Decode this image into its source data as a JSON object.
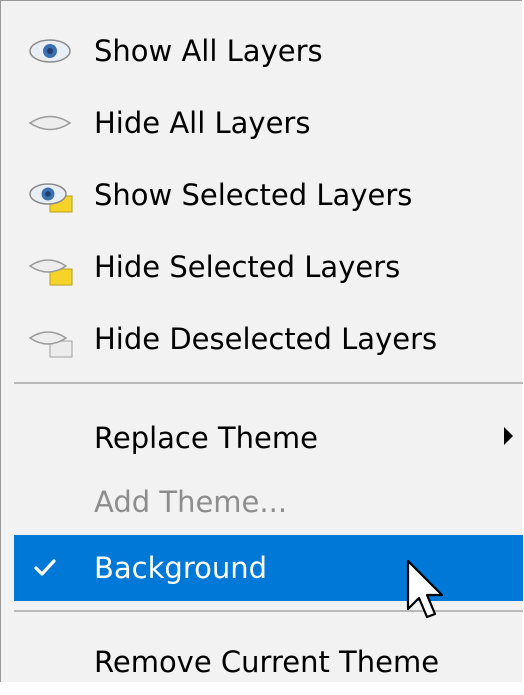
{
  "menu": {
    "items": [
      {
        "label": "Show All Layers",
        "icon": "eye-open-icon",
        "state": "enabled"
      },
      {
        "label": "Hide All Layers",
        "icon": "eye-closed-icon",
        "state": "enabled"
      },
      {
        "label": "Show Selected Layers",
        "icon": "eye-open-selected-icon",
        "state": "enabled"
      },
      {
        "label": "Hide Selected Layers",
        "icon": "eye-closed-selected-icon",
        "state": "enabled"
      },
      {
        "label": "Hide Deselected Layers",
        "icon": "eye-closed-deselected-icon",
        "state": "enabled"
      },
      {
        "label": "Replace Theme",
        "icon": "chevron-right-icon",
        "state": "enabled",
        "has_submenu": true
      },
      {
        "label": "Add Theme...",
        "state": "disabled"
      },
      {
        "label": "Background",
        "icon": "checkmark-icon",
        "state": "selected",
        "checked": true
      },
      {
        "label": "Remove Current Theme",
        "state": "enabled"
      }
    ]
  },
  "colors": {
    "menu_background": "#f2f2f2",
    "highlight": "#0078d7",
    "disabled_text": "#8d8d8d",
    "eye_blue": "#3a6fb0",
    "selection_yellow": "#f5d328"
  },
  "cursor": {
    "icon": "mouse-pointer-icon"
  }
}
